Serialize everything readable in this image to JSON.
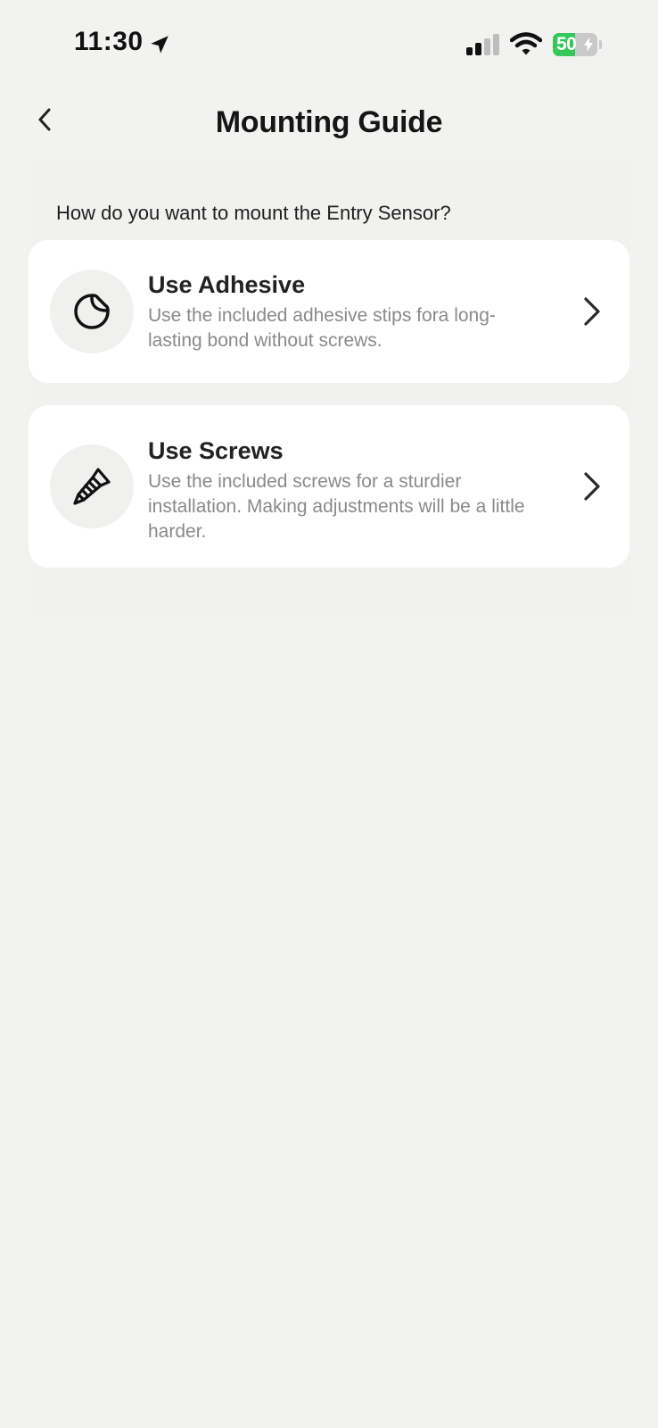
{
  "status_bar": {
    "time": "11:30",
    "battery_percent": "50",
    "battery_level": 0.5,
    "icons": [
      "location-arrow-icon",
      "cellular-signal-icon",
      "wifi-icon",
      "battery-charging-icon"
    ],
    "battery_color": "#34c759"
  },
  "nav": {
    "title": "Mounting Guide",
    "back_icon": "chevron-left-icon"
  },
  "main": {
    "question": "How do you want to mount the Entry Sensor?",
    "options": [
      {
        "title": "Use Adhesive",
        "description": "Use the included adhesive stips fora long-lasting bond without screws.",
        "icon": "adhesive-sticker-icon",
        "chevron": "chevron-right-icon"
      },
      {
        "title": "Use Screws",
        "description": "Use the included screws for a sturdier installation. Making adjustments will be a little harder.",
        "icon": "screw-icon",
        "chevron": "chevron-right-icon"
      }
    ]
  },
  "colors": {
    "background": "#f2f2f1",
    "card": "#ffffff",
    "description_text": "#8a8a8a"
  }
}
